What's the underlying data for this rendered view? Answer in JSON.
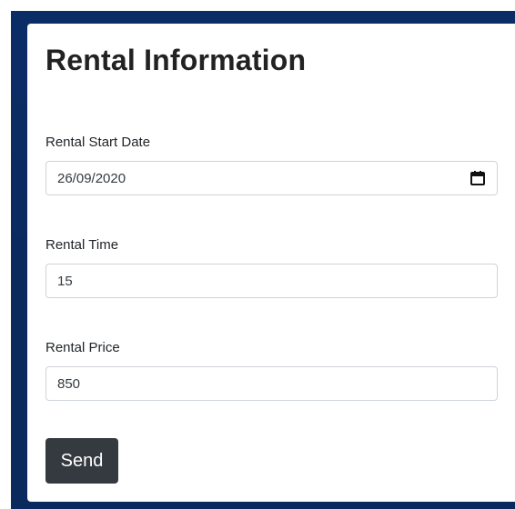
{
  "form": {
    "title": "Rental Information",
    "start_date": {
      "label": "Rental Start Date",
      "value": "26/09/2020",
      "icon": "calendar-icon"
    },
    "rental_time": {
      "label": "Rental Time",
      "value": "15"
    },
    "rental_price": {
      "label": "Rental Price",
      "value": "850"
    },
    "send_label": "Send"
  },
  "colors": {
    "background": "#0a2a5e",
    "button": "#343a40",
    "input_border": "#ced4da"
  }
}
